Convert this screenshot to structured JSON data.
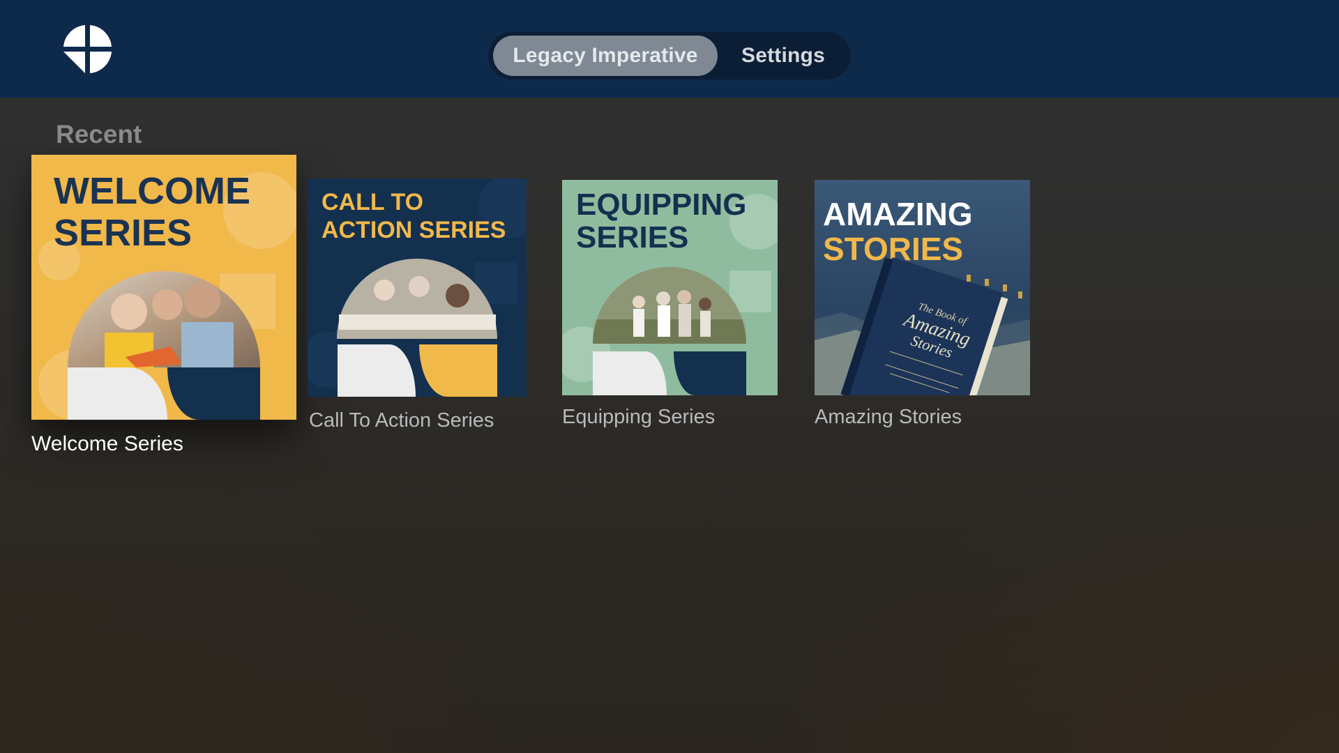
{
  "header": {
    "logo_icon": "cross-quadrant-logo-icon",
    "tabs": [
      {
        "label": "Legacy Imperative",
        "active": true
      },
      {
        "label": "Settings",
        "active": false
      }
    ]
  },
  "recent": {
    "title": "Recent",
    "items": [
      {
        "label": "Welcome Series",
        "art_title_lines": [
          "WELCOME",
          "SERIES"
        ],
        "colors": {
          "bg": "#f1b84a",
          "title": "#1b3352",
          "accent": "#13304f",
          "light": "#ececec"
        },
        "focused": true
      },
      {
        "label": "Call To Action Series",
        "art_title_lines": [
          "CALL TO",
          "ACTION SERIES"
        ],
        "colors": {
          "bg": "#13304f",
          "title": "#f1b84a",
          "accent": "#f1b84a",
          "light": "#ececec"
        },
        "focused": false
      },
      {
        "label": "Equipping Series",
        "art_title_lines": [
          "EQUIPPING",
          "SERIES"
        ],
        "colors": {
          "bg": "#8fbc9e",
          "title": "#13304f",
          "accent": "#13304f",
          "light": "#ececec"
        },
        "focused": false
      },
      {
        "label": "Amazing Stories",
        "art_title_lines": [
          "AMAZING",
          "STORIES"
        ],
        "book_text": [
          "The Book of",
          "Amazing",
          "Stories"
        ],
        "colors": {
          "bg": "#2f4a68",
          "title_line1": "#ffffff",
          "title_line2": "#f1b84a",
          "book": "#1b3458"
        },
        "focused": false
      }
    ]
  }
}
